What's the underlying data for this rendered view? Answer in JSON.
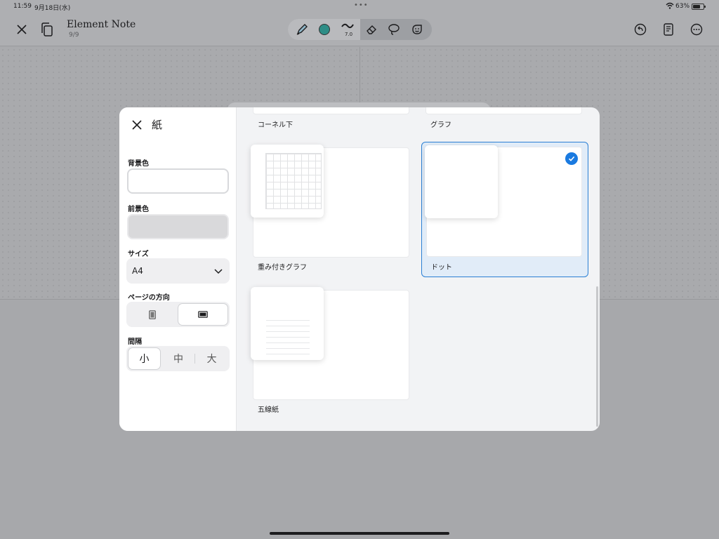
{
  "status_bar": {
    "time": "11:59",
    "date": "9月18日(水)",
    "battery": "63%"
  },
  "app": {
    "title": "Element Note",
    "pages": "9/9",
    "pen_width": "7.0",
    "pen_color": "#2e8d86"
  },
  "sheet": {
    "title": "紙",
    "background_label": "背景色",
    "foreground_label": "前景色",
    "size_label": "サイズ",
    "size_value": "A4",
    "orientation_label": "ページの方向",
    "spacing_label": "間隔",
    "spacing_options": [
      "小",
      "中",
      "大"
    ],
    "spacing_selected": "小"
  },
  "papers": [
    {
      "label": "コーネル下"
    },
    {
      "label": "グラフ"
    },
    {
      "label": "重み付きグラフ"
    },
    {
      "label": "ドット",
      "selected": true
    },
    {
      "label": "五線紙"
    }
  ]
}
